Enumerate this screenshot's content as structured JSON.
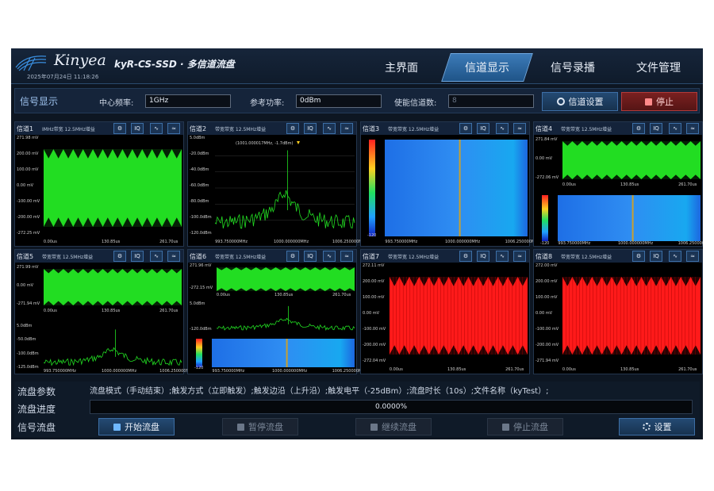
{
  "header": {
    "brand": "Kinyea",
    "model": "kyR-CS-SSD · 多信道流盘",
    "datetime": "2025年07月24日 11:18:26",
    "tabs": [
      {
        "label": "主界面"
      },
      {
        "label": "信道显示"
      },
      {
        "label": "信号录播"
      },
      {
        "label": "文件管理"
      }
    ]
  },
  "toolbar": {
    "title": "信号显示",
    "center_freq_label": "中心频率:",
    "center_freq_value": "1GHz",
    "ref_power_label": "参考功率:",
    "ref_power_value": "0dBm",
    "enabled_ch_label": "使能信道数:",
    "enabled_ch_value": "8",
    "ch_settings_label": "信道设置",
    "stop_label": "停止"
  },
  "channels": [
    {
      "name": "信道1",
      "desc": "IMHz带宽 12.5MHz增益",
      "y": [
        "271.98 mV",
        "200.00 mV",
        "100.00 mV",
        "0.00 mV",
        "-100.00 mV",
        "-200.00 mV",
        "-272.25 mV"
      ],
      "x": [
        "0.00us",
        "130.85us",
        "261.70us"
      ]
    },
    {
      "name": "信道2",
      "desc": "带宽带宽 12.5MHz增益",
      "y": [
        "5.0dBm",
        "-20.0dBm",
        "-40.0dBm",
        "-60.0dBm",
        "-80.0dBm",
        "-100.0dBm",
        "-120.0dBm"
      ],
      "x": [
        "993.750000MHz",
        "1000.000000MHz",
        "1006.250000MHz"
      ],
      "marker": "(1001.000017MHz, -1.7dBm)"
    },
    {
      "name": "信道3",
      "desc": "带宽带宽 12.5MHz增益",
      "x": [
        "993.750000MHz",
        "1000.000000MHz",
        "1006.250000MHz"
      ],
      "cbar": "-120"
    },
    {
      "name": "信道4",
      "desc": "带宽带宽 12.5MHz增益",
      "y": [
        "271.84 mV",
        "0.00 mV",
        "-272.06 mV"
      ],
      "x": [
        "0.00us",
        "130.85us",
        "261.70us"
      ],
      "x2": [
        "993.750000MHz",
        "1000.000000MHz",
        "1006.250000MHz"
      ],
      "cbar": "-120"
    },
    {
      "name": "信道5",
      "desc": "带宽带宽 12.5MHz增益",
      "y": [
        "271.99 mV",
        "0.00 mV",
        "-271.94 mV"
      ],
      "x": [
        "0.00us",
        "130.85us",
        "261.70us"
      ],
      "y2": [
        "5.0dBm",
        "-50.0dBm",
        "-100.0dBm",
        "-125.0dBm"
      ],
      "x2": [
        "993.750000MHz",
        "1000.000000MHz",
        "1006.250000MHz"
      ]
    },
    {
      "name": "信道6",
      "desc": "带宽带宽 12.5MHz增益",
      "y": [
        "271.96 mV",
        "-272.15 mV"
      ],
      "x": [
        "0.00us",
        "130.85us",
        "261.70us"
      ],
      "y2": [
        "5.0dBm",
        "-120.0dBm"
      ],
      "x2": [
        "993.750000MHz",
        "1000.000000MHz",
        "1006.250000MHz"
      ],
      "cbar": "-120"
    },
    {
      "name": "信道7",
      "desc": "带宽带宽 12.5MHz增益",
      "y": [
        "272.11 mV",
        "200.00 mV",
        "100.00 mV",
        "0.00 mV",
        "-100.00 mV",
        "-200.00 mV",
        "-272.04 mV"
      ],
      "x": [
        "0.00us",
        "130.85us",
        "261.70us"
      ]
    },
    {
      "name": "信道8",
      "desc": "带宽带宽 12.5MHz增益",
      "y": [
        "272.00 mV",
        "200.00 mV",
        "100.00 mV",
        "0.00 mV",
        "-100.00 mV",
        "-200.00 mV",
        "-271.94 mV"
      ],
      "x": [
        "0.00us",
        "130.85us",
        "261.70us"
      ]
    }
  ],
  "icons": {
    "gear": "gear-icon",
    "iq": "IQ",
    "wave": "wave-icon",
    "spec": "spectrum-icon"
  },
  "bottom": {
    "params_label": "流盘参数",
    "params": "流盘模式（手动结束）;触发方式（立即触发）;触发边沿（上升沿）;触发电平（-25dBm）;流盘时长（10s）;文件名称（kyTest）;",
    "progress_label": "流盘进度",
    "progress": "0.0000%",
    "stream_label": "信号流盘",
    "start": "开始流盘",
    "pause": "暂停流盘",
    "resume": "继续流盘",
    "stop": "停止流盘",
    "settings": "设置"
  },
  "colors": {
    "accent": "#3c7bb8",
    "time": "#22dd22",
    "red": "#ff1a1a",
    "stop": "#b23a3a"
  }
}
